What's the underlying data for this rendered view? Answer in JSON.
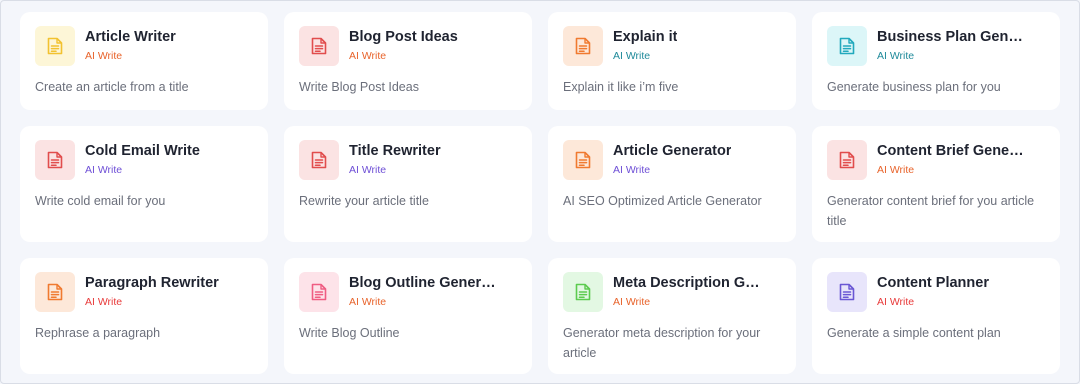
{
  "tools": [
    {
      "title": "Article Writer",
      "tag": "AI Write",
      "desc": "Create an article from a title",
      "icon": "document-icon",
      "tile_bg": "#fdf6d7",
      "icon_color": "#f2c230",
      "tag_color": "#e8632b"
    },
    {
      "title": "Blog Post Ideas",
      "tag": "AI Write",
      "desc": "Write Blog Post Ideas",
      "icon": "document-icon",
      "tile_bg": "#fbe3e3",
      "icon_color": "#e14d4d",
      "tag_color": "#e8632b"
    },
    {
      "title": "Explain it",
      "tag": "AI Write",
      "desc": "Explain it like i’m five",
      "icon": "document-icon",
      "tile_bg": "#fde8d9",
      "icon_color": "#f07a30",
      "tag_color": "#1f8a9a"
    },
    {
      "title": "Business Plan Gene…",
      "tag": "AI Write",
      "desc": "Generate business plan for you",
      "icon": "document-icon",
      "tile_bg": "#dcf6f8",
      "icon_color": "#22a9bd",
      "tag_color": "#1f8a9a"
    },
    {
      "title": "Cold Email Write",
      "tag": "AI Write",
      "desc": "Write cold email for you",
      "icon": "document-icon",
      "tile_bg": "#fbe3e3",
      "icon_color": "#e14d4d",
      "tag_color": "#6e4fd6"
    },
    {
      "title": "Title Rewriter",
      "tag": "AI Write",
      "desc": "Rewrite your article title",
      "icon": "document-icon",
      "tile_bg": "#fbe3e3",
      "icon_color": "#e14d4d",
      "tag_color": "#6e4fd6"
    },
    {
      "title": "Article Generator",
      "tag": "AI Write",
      "desc": "AI SEO Optimized Article Generator",
      "icon": "document-icon",
      "tile_bg": "#fde8d9",
      "icon_color": "#f07a30",
      "tag_color": "#6e4fd6"
    },
    {
      "title": "Content Brief Gener…",
      "tag": "AI Write",
      "desc": "Generator content brief for you article title",
      "icon": "document-icon",
      "tile_bg": "#fbe3e3",
      "icon_color": "#e14d4d",
      "tag_color": "#e8632b"
    },
    {
      "title": "Paragraph Rewriter",
      "tag": "AI Write",
      "desc": "Rephrase a paragraph",
      "icon": "document-icon",
      "tile_bg": "#fde8d9",
      "icon_color": "#f07a30",
      "tag_color": "#e83a3a"
    },
    {
      "title": "Blog Outline Genera…",
      "tag": "AI Write",
      "desc": "Write Blog Outline",
      "icon": "document-icon",
      "tile_bg": "#fde3e9",
      "icon_color": "#ef5d82",
      "tag_color": "#e8632b"
    },
    {
      "title": "Meta Description G…",
      "tag": "AI Write",
      "desc": "Generator meta description for your article",
      "icon": "document-icon",
      "tile_bg": "#e3f8e3",
      "icon_color": "#5ccb4f",
      "tag_color": "#e8632b"
    },
    {
      "title": "Content Planner",
      "tag": "AI Write",
      "desc": "Generate a simple content plan",
      "icon": "document-icon",
      "tile_bg": "#e8e5fb",
      "icon_color": "#6a57d4",
      "tag_color": "#e83a3a"
    }
  ]
}
